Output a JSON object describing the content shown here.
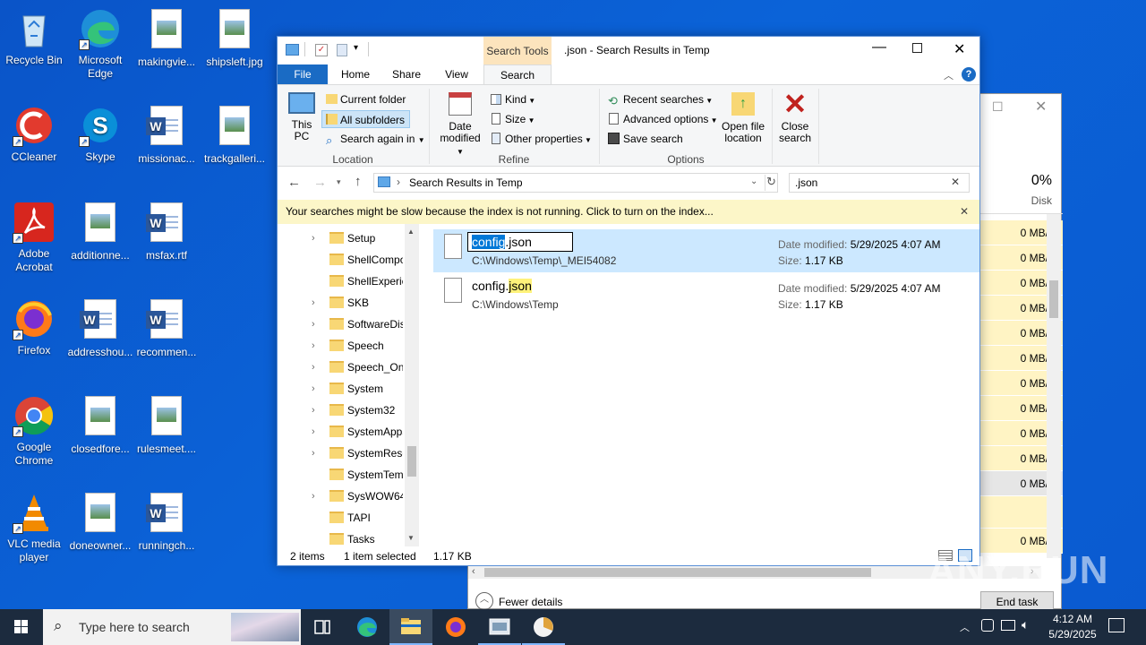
{
  "desktop": {
    "icons": [
      {
        "label": "Recycle Bin",
        "icon": "recycle-bin-icon"
      },
      {
        "label": "Microsoft Edge",
        "icon": "edge-icon"
      },
      {
        "label": "makingvie...",
        "icon": "image-file-icon"
      },
      {
        "label": "shipsleft.jpg",
        "icon": "image-file-icon"
      },
      {
        "label": "CCleaner",
        "icon": "ccleaner-icon"
      },
      {
        "label": "Skype",
        "icon": "skype-icon"
      },
      {
        "label": "missionac...",
        "icon": "word-doc-icon"
      },
      {
        "label": "trackgalleri...",
        "icon": "image-file-icon"
      },
      {
        "label": "Adobe Acrobat",
        "icon": "acrobat-icon"
      },
      {
        "label": "additionne...",
        "icon": "image-file-icon"
      },
      {
        "label": "msfax.rtf",
        "icon": "word-doc-icon"
      },
      {
        "label": "Firefox",
        "icon": "firefox-icon"
      },
      {
        "label": "addresshou...",
        "icon": "word-doc-icon"
      },
      {
        "label": "recommen...",
        "icon": "word-doc-icon"
      },
      {
        "label": "Google Chrome",
        "icon": "chrome-icon"
      },
      {
        "label": "closedfore...",
        "icon": "image-file-icon"
      },
      {
        "label": "rulesmeet....",
        "icon": "image-file-icon"
      },
      {
        "label": "VLC media player",
        "icon": "vlc-icon"
      },
      {
        "label": "doneowner...",
        "icon": "image-file-icon"
      },
      {
        "label": "runningch...",
        "icon": "word-doc-icon"
      }
    ]
  },
  "explorer": {
    "title": ".json - Search Results in Temp",
    "context_tab": "Search Tools",
    "tabs": [
      "File",
      "Home",
      "Share",
      "View",
      "Search"
    ],
    "ribbon": {
      "location": {
        "this_pc": "This PC",
        "current_folder": "Current folder",
        "all_subfolders": "All subfolders",
        "search_again": "Search again in",
        "group": "Location"
      },
      "refine": {
        "date_modified": "Date modified",
        "kind": "Kind",
        "size": "Size",
        "other_properties": "Other properties",
        "group": "Refine"
      },
      "options": {
        "recent_searches": "Recent searches",
        "advanced_options": "Advanced options",
        "save_search": "Save search",
        "open_file_location": "Open file location",
        "group": "Options"
      },
      "close_search": "Close search"
    },
    "address": "Search Results in Temp",
    "search_value": ".json",
    "infobar": "Your searches might be slow because the index is not running.  Click to turn on the index...",
    "nav_items": [
      {
        "name": "Setup",
        "expandable": true
      },
      {
        "name": "ShellCompo",
        "expandable": false
      },
      {
        "name": "ShellExperie",
        "expandable": false
      },
      {
        "name": "SKB",
        "expandable": true
      },
      {
        "name": "SoftwareDis",
        "expandable": true
      },
      {
        "name": "Speech",
        "expandable": true
      },
      {
        "name": "Speech_One",
        "expandable": true
      },
      {
        "name": "System",
        "expandable": true
      },
      {
        "name": "System32",
        "expandable": true
      },
      {
        "name": "SystemApps",
        "expandable": true
      },
      {
        "name": "SystemReso",
        "expandable": true
      },
      {
        "name": "SystemTemp",
        "expandable": false
      },
      {
        "name": "SysWOW64",
        "expandable": true
      },
      {
        "name": "TAPI",
        "expandable": false
      },
      {
        "name": "Tasks",
        "expandable": false
      }
    ],
    "results": [
      {
        "name_prefix": "config",
        "name_suffix": ".json",
        "path": "C:\\Windows\\Temp\\_MEI54082",
        "date_label": "Date modified:",
        "date": "5/29/2025 4:07 AM",
        "size_label": "Size:",
        "size": "1.17 KB",
        "selected": true
      },
      {
        "name_prefix": "config.",
        "name_suffix": "json",
        "path": "C:\\Windows\\Temp",
        "date_label": "Date modified:",
        "date": "5/29/2025 4:07 AM",
        "size_label": "Size:",
        "size": "1.17 KB",
        "selected": false
      }
    ],
    "status": {
      "items": "2 items",
      "selected": "1 item selected",
      "size": "1.17 KB"
    }
  },
  "taskmgr": {
    "disk_percent": "0%",
    "disk_label": "Disk",
    "rows": [
      "0 MB/s",
      "0 MB/s",
      "0 MB/s",
      "0 MB/s",
      "0 MB/s",
      "0 MB/s",
      "0 MB/s",
      "0 MB/s",
      "0 MB/s",
      "0 MB/s",
      "0 MB/s"
    ],
    "last_row": "0 MB/s",
    "fewer_details": "Fewer details",
    "end_task": "End task"
  },
  "taskbar": {
    "search_placeholder": "Type here to search",
    "time": "4:12 AM",
    "date": "5/29/2025"
  },
  "watermark": "ANY.RUN"
}
